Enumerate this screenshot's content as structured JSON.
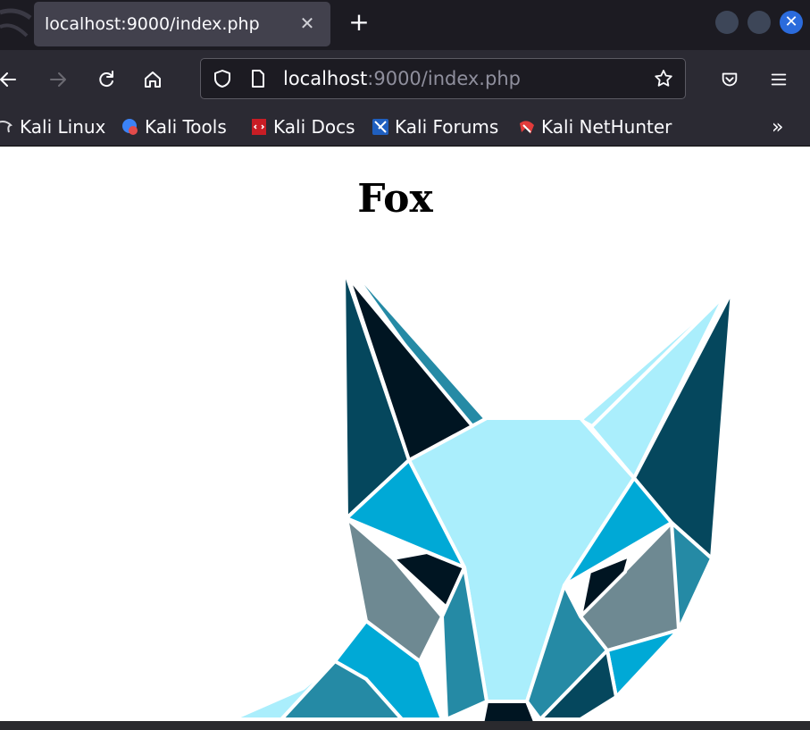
{
  "browser": {
    "tab_title": "localhost:9000/index.php",
    "tab_close_icon": "close-icon",
    "new_tab_icon": "plus-icon",
    "window_controls": [
      "minimize-button",
      "maximize-button",
      "close-window-button"
    ]
  },
  "navbar": {
    "url_host": "localhost",
    "url_path": ":9000/index.php",
    "icons": [
      "back-icon",
      "forward-icon",
      "reload-icon",
      "home-icon",
      "shield-icon",
      "page-icon",
      "star-icon",
      "pocket-icon",
      "menu-icon"
    ]
  },
  "bookmarks": [
    {
      "label": "Kali Linux",
      "icon": "kali-dragon-icon"
    },
    {
      "label": "Kali Tools",
      "icon": "kali-tools-icon"
    },
    {
      "label": "Kali Docs",
      "icon": "kali-docs-icon"
    },
    {
      "label": "Kali Forums",
      "icon": "kali-forums-icon"
    },
    {
      "label": "Kali NetHunter",
      "icon": "kali-nethunter-icon"
    }
  ],
  "bookmarks_more_icon": "chevron-double-right-icon",
  "page": {
    "heading": "Fox",
    "image": "geometric-fox-image"
  },
  "colors": {
    "tabstrip": "#1c1b22",
    "toolbar": "#2b2a33",
    "tab_active": "#42414d",
    "accent_blue": "#2b6bdc",
    "fox_light": "#aaeefc",
    "fox_mid": "#00a9d6",
    "fox_teal": "#258aa5",
    "fox_dark": "#05475d",
    "fox_navy": "#001522",
    "fox_gray": "#6e8992"
  }
}
